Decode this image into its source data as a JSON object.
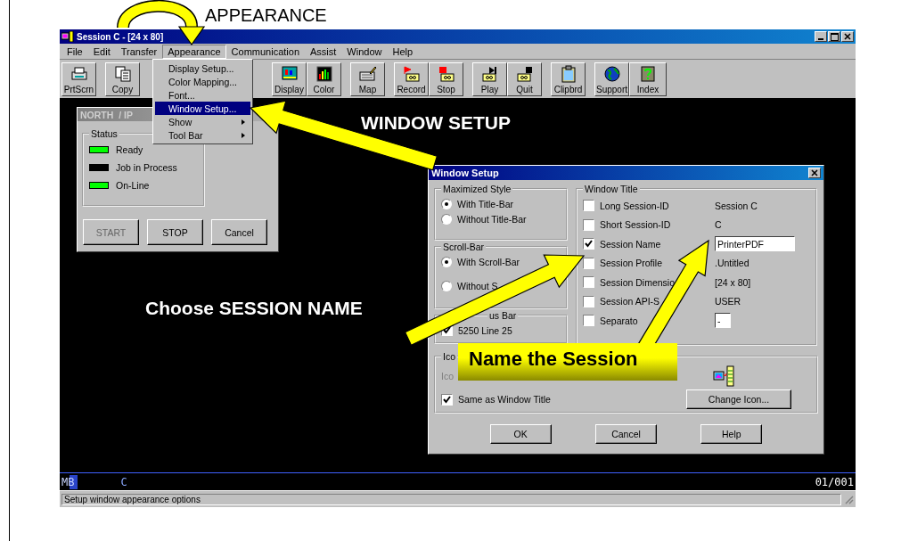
{
  "annotations": [
    {
      "kind": "caption",
      "text": "APPEARANCE"
    },
    {
      "kind": "callout",
      "text": "WINDOW SETUP"
    },
    {
      "kind": "callout",
      "text": "Choose SESSION NAME"
    },
    {
      "kind": "banner",
      "text": "Name the Session"
    }
  ],
  "window": {
    "title": "Session C - [24 x 80]"
  },
  "menu_bar": [
    {
      "label": "File",
      "selected": false
    },
    {
      "label": "Edit",
      "selected": false
    },
    {
      "label": "Transfer",
      "selected": false
    },
    {
      "label": "Appearance",
      "selected": true
    },
    {
      "label": "Communication",
      "selected": false
    },
    {
      "label": "Assist",
      "selected": false
    },
    {
      "label": "Window",
      "selected": false
    },
    {
      "label": "Help",
      "selected": false
    }
  ],
  "toolbar": [
    {
      "buttons": [
        "PrtScrn"
      ]
    },
    {
      "buttons": [
        "Copy"
      ]
    },
    {
      "buttons": [
        "Display",
        "Color"
      ]
    },
    {
      "buttons": [
        "Map"
      ]
    },
    {
      "buttons": [
        "Record",
        "Stop"
      ]
    },
    {
      "buttons": [
        "Play",
        "Quit"
      ]
    },
    {
      "buttons": [
        "Clipbrd"
      ]
    },
    {
      "buttons": [
        "Support",
        "Index"
      ]
    }
  ],
  "dropdown": [
    {
      "label": "Display Setup...",
      "selected": false,
      "submenu": false
    },
    {
      "label": "Color Mapping...",
      "selected": false,
      "submenu": false
    },
    {
      "label": "Font...",
      "selected": false,
      "submenu": false
    },
    {
      "label": "Window Setup...",
      "selected": true,
      "submenu": false
    },
    {
      "label": "Show",
      "selected": false,
      "submenu": true
    },
    {
      "label": "Tool Bar",
      "selected": false,
      "submenu": true
    }
  ],
  "printer_dialog": {
    "title": "NORTH  / IP",
    "group": "Status",
    "indicators": [
      {
        "label": "Ready",
        "color": "#00ff00"
      },
      {
        "label": "Job in Process",
        "color": "#000000"
      },
      {
        "label": "On-Line",
        "color": "#00ff00"
      }
    ],
    "buttons": [
      {
        "label": "START",
        "disabled": true
      },
      {
        "label": "STOP",
        "disabled": false
      },
      {
        "label": "Cancel",
        "disabled": false
      }
    ]
  },
  "window_setup": {
    "title": "Window Setup",
    "maximized_style": {
      "label": "Maximized Style",
      "options": [
        {
          "label": "With Title-Bar",
          "selected": true
        },
        {
          "label": "Without Title-Bar",
          "selected": false
        }
      ]
    },
    "scroll_bar": {
      "label": "Scroll-Bar",
      "options": [
        {
          "label": "With Scroll-Bar",
          "selected": true
        },
        {
          "label": "Without S",
          "selected": false
        }
      ]
    },
    "status_bar": {
      "label": "us Bar",
      "checkbox": {
        "label": "5250 Line 25",
        "checked": true
      }
    },
    "window_title": {
      "label": "Window Title",
      "rows": [
        {
          "label": "Long Session-ID",
          "checked": false,
          "kind": "text",
          "value": "Session C"
        },
        {
          "label": "Short Session-ID",
          "checked": false,
          "kind": "text",
          "value": "C"
        },
        {
          "label": "Session Name",
          "checked": true,
          "kind": "field",
          "value": "PrinterPDF"
        },
        {
          "label": "Session Profile",
          "checked": false,
          "kind": "text",
          "value": ".Untitled"
        },
        {
          "label": "Session Dimensio",
          "checked": false,
          "kind": "text",
          "value": "[24 x 80]"
        },
        {
          "label": "Session API-S",
          "checked": false,
          "kind": "text",
          "value": "USER"
        },
        {
          "label": "Separato",
          "checked": false,
          "kind": "field",
          "value": "-"
        }
      ]
    },
    "icon": {
      "label": "Ico",
      "text": "Ico",
      "same_as_title": {
        "label": "Same as Window Title",
        "checked": true
      },
      "change_button": "Change Icon..."
    },
    "buttons": [
      "OK",
      "Cancel",
      "Help"
    ]
  },
  "operator_line": {
    "indicator": "MB",
    "session": "C",
    "position": "01/001"
  },
  "status_bar": "Setup window appearance options"
}
